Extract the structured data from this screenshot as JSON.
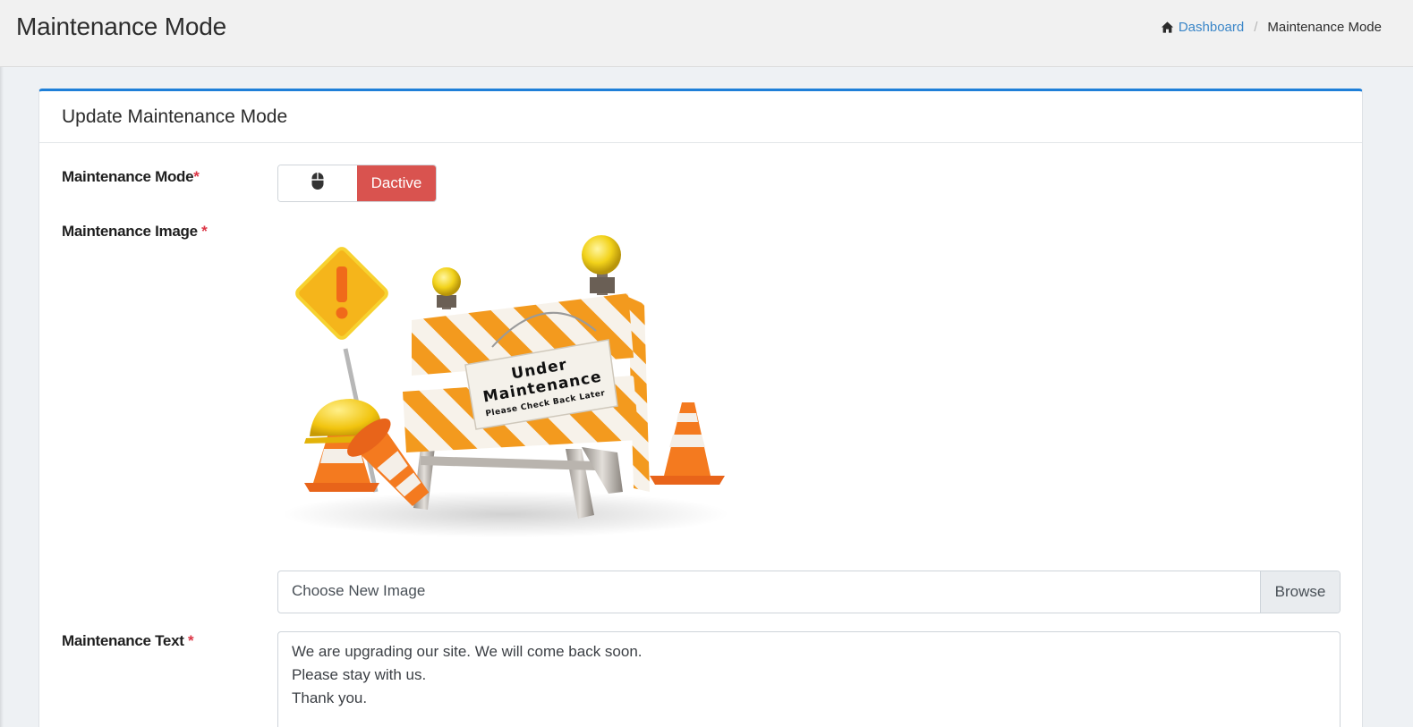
{
  "header": {
    "title": "Maintenance Mode",
    "breadcrumb": {
      "home_label": "Dashboard",
      "current": "Maintenance Mode"
    }
  },
  "card": {
    "title": "Update Maintenance Mode",
    "mode": {
      "label": "Maintenance Mode",
      "required_mark": "*",
      "status_text": "Dactive"
    },
    "image": {
      "label": "Maintenance Image",
      "required_mark": "*",
      "sign_line1": "Under",
      "sign_line2": "Maintenance",
      "sign_line3": "Please Check Back Later"
    },
    "file_input": {
      "placeholder": "Choose New Image",
      "button_label": "Browse"
    },
    "text": {
      "label": "Maintenance Text",
      "required_mark": "*",
      "lines": [
        "We are upgrading our site. We will come back soon.",
        "Please stay with us.",
        "Thank you."
      ]
    }
  },
  "colors": {
    "accent": "#1e7fd8",
    "link": "#3a86c8",
    "danger": "#d9534f",
    "required": "#dc3545"
  },
  "icons": {
    "breadcrumb_home": "home-icon",
    "toggle_handle": "mouse-icon"
  }
}
